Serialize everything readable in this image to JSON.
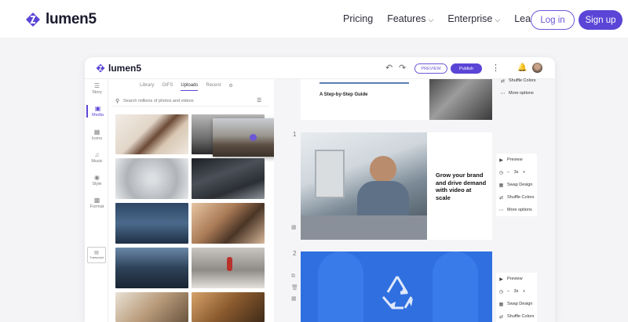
{
  "site": {
    "brand": "lumen5",
    "nav": [
      "Pricing",
      "Features",
      "Enterprise",
      "Learn"
    ],
    "nav_has_dropdown": [
      false,
      true,
      true,
      true
    ],
    "login": "Log in",
    "signup": "Sign up",
    "accent_color": "#5a45d6"
  },
  "app": {
    "brand": "lumen5",
    "preview": "PREVIEW",
    "publish": "Publish",
    "rail": [
      {
        "label": "Story",
        "icon": "list-icon"
      },
      {
        "label": "Media",
        "icon": "image-icon"
      },
      {
        "label": "Icons",
        "icon": "grid-icon"
      },
      {
        "label": "Music",
        "icon": "music-icon"
      },
      {
        "label": "Style",
        "icon": "palette-icon"
      },
      {
        "label": "Format",
        "icon": "format-icon"
      }
    ],
    "rail_extra": "Transcript",
    "tabs": [
      "Library",
      "GIFS",
      "Uploads",
      "Recent"
    ],
    "active_tab": "Uploads",
    "search_placeholder": "Search millions of photos and videos",
    "canvas": {
      "slide0_caption": "A Step-by-Step Guide",
      "slide1_number": "1",
      "slide1_heading": "Grow your brand and drive demand with video at scale",
      "slide2_number": "2",
      "menu": {
        "preview": "Preview",
        "duration": "3s",
        "swap": "Swap Design",
        "shuffle": "Shuffle Colors",
        "more": "More options"
      }
    }
  }
}
